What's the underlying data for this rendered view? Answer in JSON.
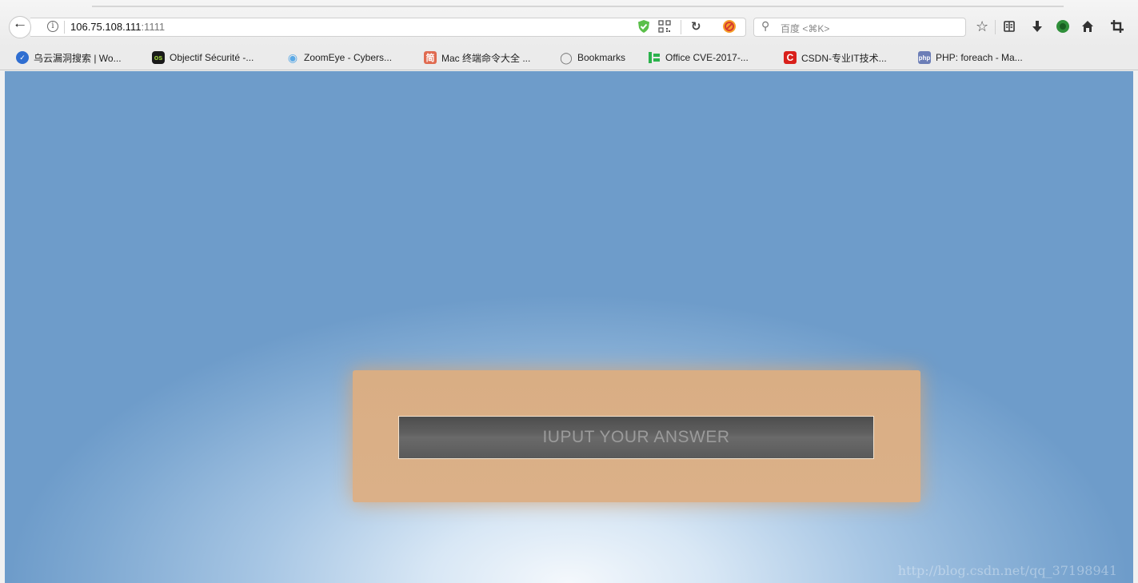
{
  "browser": {
    "url_host": "106.75.108.111",
    "url_port": ":1111",
    "search_placeholder": "百度 <⌘K>",
    "info_glyph": "i"
  },
  "bookmarks": [
    {
      "label": "乌云漏洞搜索 | Wo...",
      "icon": "shield-icon",
      "icon_text": "",
      "color": "#3a6fd8"
    },
    {
      "label": "Objectif Sécurité -...",
      "icon": "os-logo-icon",
      "icon_text": "os",
      "color": "#1a1a1a"
    },
    {
      "label": "ZoomEye - Cybers...",
      "icon": "eye-icon",
      "icon_text": "",
      "color": "#5aa9e6"
    },
    {
      "label": "Mac 终端命令大全 ...",
      "icon": "jian-icon",
      "icon_text": "简",
      "color": "#e06a50"
    },
    {
      "label": "Bookmarks",
      "icon": "globe-icon",
      "icon_text": "",
      "color": "#888888"
    },
    {
      "label": "Office CVE-2017-...",
      "icon": "green-bars-icon",
      "icon_text": "",
      "color": "#2bb24c"
    },
    {
      "label": "CSDN-专业IT技术...",
      "icon": "csdn-logo-icon",
      "icon_text": "C",
      "color": "#d9201b"
    },
    {
      "label": "PHP: foreach - Ma...",
      "icon": "php-logo-icon",
      "icon_text": "php",
      "color": "#6c7eb7"
    }
  ],
  "page": {
    "answer_placeholder": "IUPUT YOUR ANSWER",
    "watermark": "http://blog.csdn.net/qq_37198941"
  }
}
